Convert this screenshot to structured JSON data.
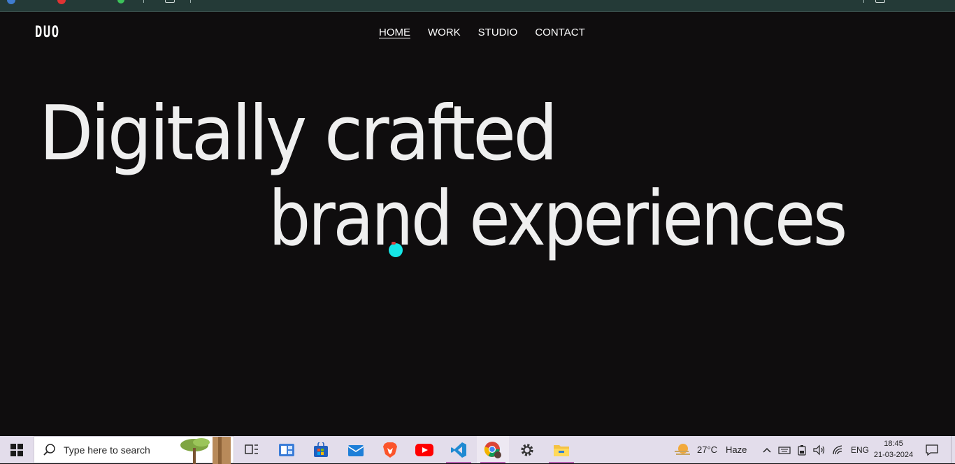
{
  "site": {
    "logo": "DUO",
    "nav": [
      {
        "label": "HOME",
        "active": true
      },
      {
        "label": "WORK",
        "active": false
      },
      {
        "label": "STUDIO",
        "active": false
      },
      {
        "label": "CONTACT",
        "active": false
      }
    ],
    "hero_line1": "Digitally crafted",
    "hero_line2": "brand experiences"
  },
  "taskbar": {
    "search_placeholder": "Type here to search",
    "apps": [
      "task-view",
      "file-explorer-app",
      "microsoft-store",
      "mail",
      "brave",
      "youtube",
      "vscode",
      "chrome",
      "settings",
      "file-explorer"
    ],
    "weather_temp": "27°C",
    "weather_desc": "Haze",
    "language": "ENG",
    "time": "18:45",
    "date": "21-03-2024"
  },
  "colors": {
    "background": "#0f0d0e",
    "text": "#efefef",
    "cursor": "#16e6e6",
    "taskbar": "#e3ddeb"
  }
}
